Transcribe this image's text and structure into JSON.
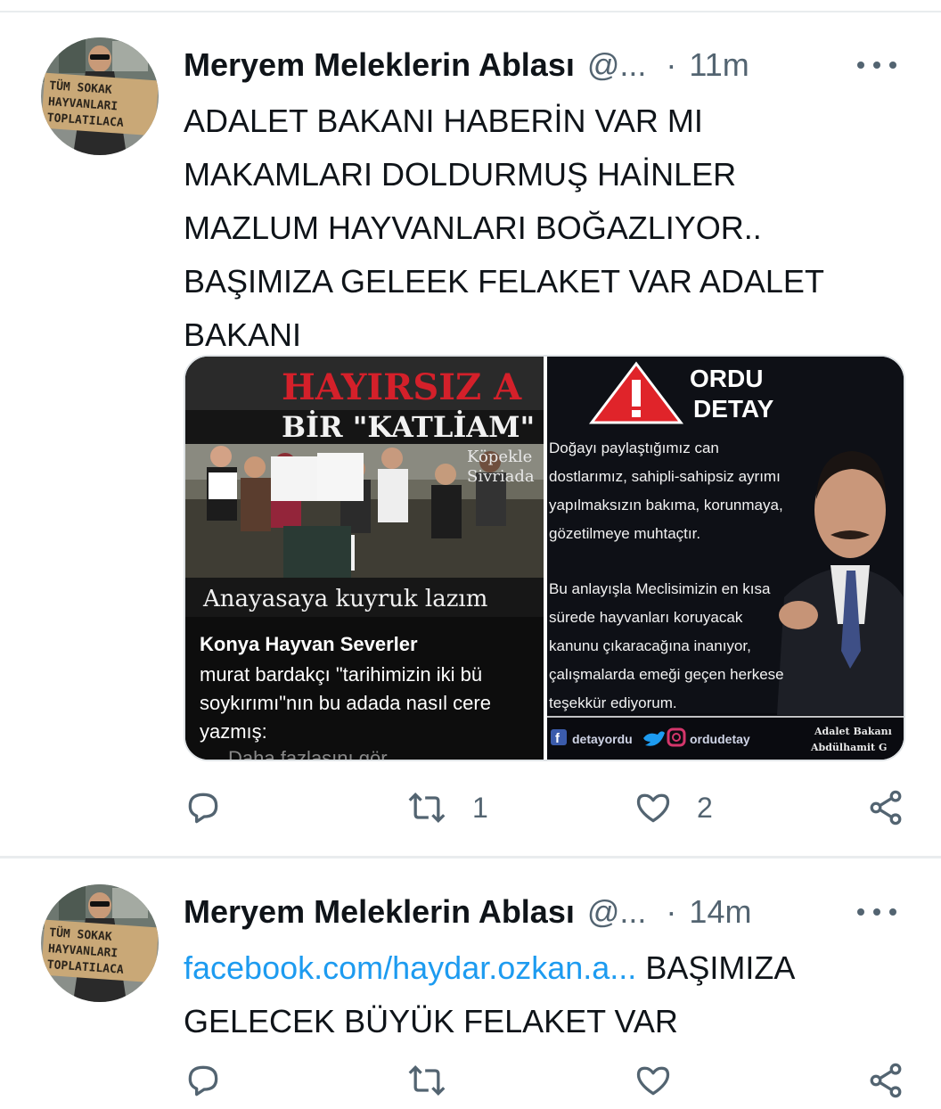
{
  "tweets": [
    {
      "author": {
        "name": "Meryem Meleklerin Ablası",
        "handle": "@...",
        "avatar_sign": [
          "TÜM SOKAK",
          "HAYVANLARI",
          "TOPLATILACA"
        ]
      },
      "time": "11m",
      "text_lines": [
        "ADALET BAKANI HABERİN VAR MI",
        "MAKAMLARI DOLDURMUŞ HAİNLER",
        "MAZLUM HAYVANLARI BOĞAZLIYOR..",
        "BAŞIMIZA GELEEK FELAKET VAR ADALET",
        "BAKANI"
      ],
      "media": {
        "left": {
          "headline": "HAYIRSIZ A",
          "subheadline": "BİR \"KATLİAM\"",
          "side_text": [
            "Köpekle",
            "Sivriada"
          ],
          "banner": "Anayasaya kuyruk lazım",
          "post_title": "Konya Hayvan Severler",
          "post_lines": [
            "murat bardakçı \"tarihimizin iki bü",
            "soykırımı\"nın bu adada nasıl cere",
            "yazmış:",
            "Daha fazlasını gör"
          ]
        },
        "right": {
          "brand_lines": [
            "ORDU",
            "DETAY"
          ],
          "quote_lines": [
            "Doğayı paylaştığımız can",
            "dostlarımız, sahipli-sahipsiz ayrımı",
            "yapılmaksızın bakıma, korunmaya,",
            "gözetilmeye muhtaçtır.",
            "",
            "Bu anlayışla Meclisimizin en kısa",
            "sürede hayvanları koruyacak",
            "kanunu çıkaracağına inanıyor,",
            "çalışmalarda emeği geçen herkese",
            "teşekkür ediyorum."
          ],
          "footer_facebook": "detayordu",
          "footer_instagram": "ordudetay",
          "signature_lines": [
            "Adalet Bakanı",
            "Abdülhamit G"
          ]
        }
      },
      "actions": {
        "replies": "",
        "retweets": "1",
        "likes": "2"
      }
    },
    {
      "author": {
        "name": "Meryem Meleklerin Ablası",
        "handle": "@...",
        "avatar_sign": [
          "TÜM SOKAK",
          "HAYVANLARI",
          "TOPLATILACA"
        ]
      },
      "time": "14m",
      "link": "facebook.com/haydar.ozkan.a...",
      "text_after_link": " BAŞIMIZA",
      "text_line2": "GELECEK BÜYÜK FELAKET VAR"
    }
  ],
  "colors": {
    "link": "#1d9bf0",
    "secondary": "#536471",
    "primary": "#0f1419",
    "warning_red": "#e0242a"
  },
  "icons": [
    "more-icon",
    "reply-icon",
    "retweet-icon",
    "like-icon",
    "share-icon",
    "warning-icon",
    "facebook-icon",
    "twitter-icon",
    "instagram-icon"
  ]
}
